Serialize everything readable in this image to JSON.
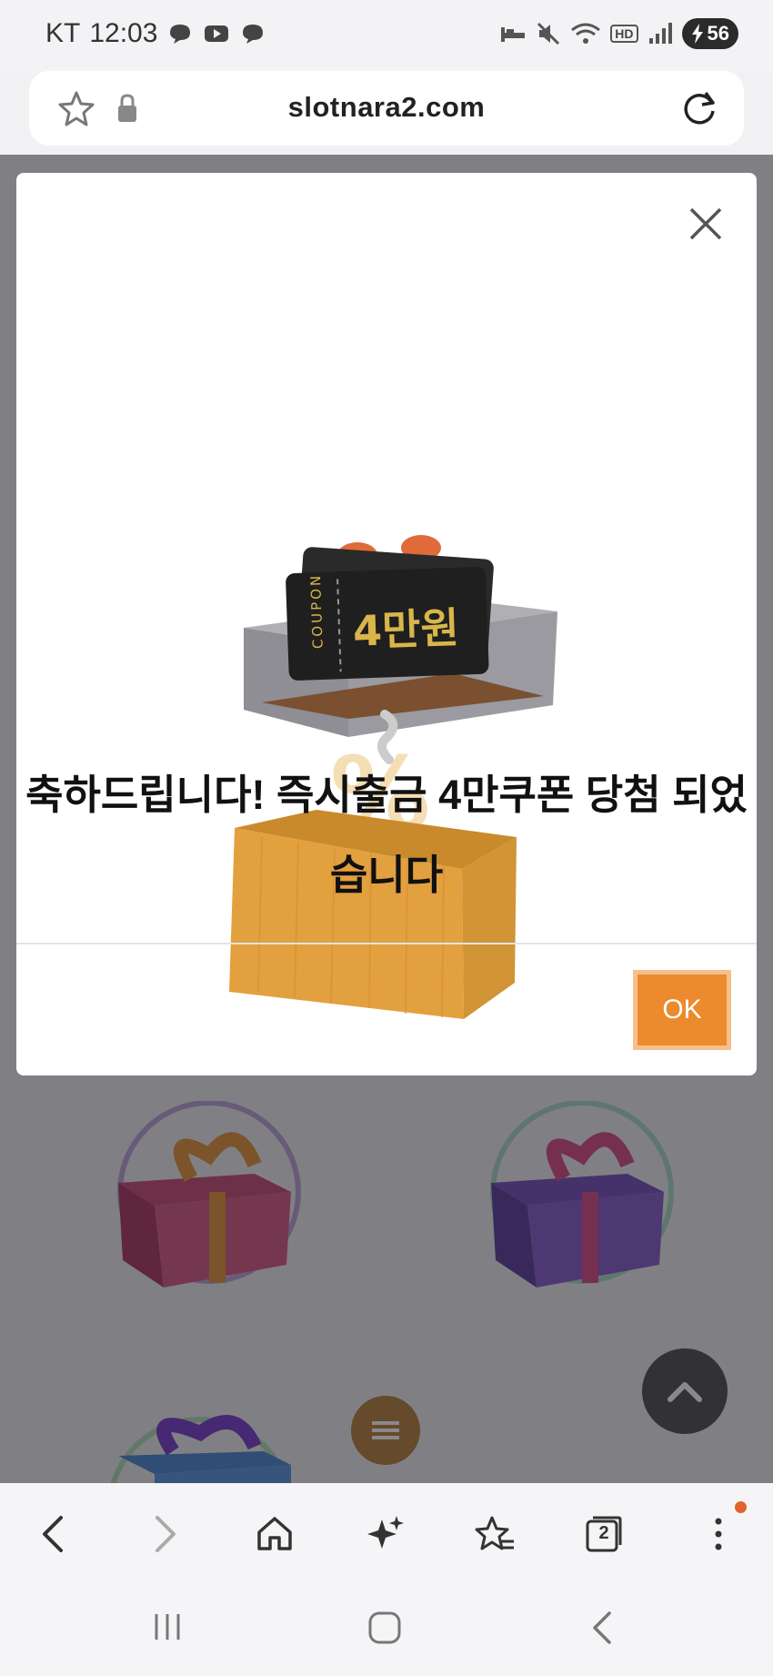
{
  "status_bar": {
    "carrier": "KT",
    "time": "12:03",
    "battery": "56",
    "network_badge": "HD"
  },
  "browser": {
    "url": "slotnara2.com"
  },
  "modal": {
    "message_line1": "축하드립니다! 즉시출금 4만쿠폰 당첨 되었",
    "message_line2": "습니다",
    "coupon_label": "COUPON",
    "coupon_value": "4만원",
    "ok_label": "OK"
  },
  "toolbar": {
    "tab_count": "2"
  },
  "colors": {
    "accent_orange": "#ec8a2e",
    "ok_border": "#f6c08e",
    "overlay": "#28282c"
  }
}
